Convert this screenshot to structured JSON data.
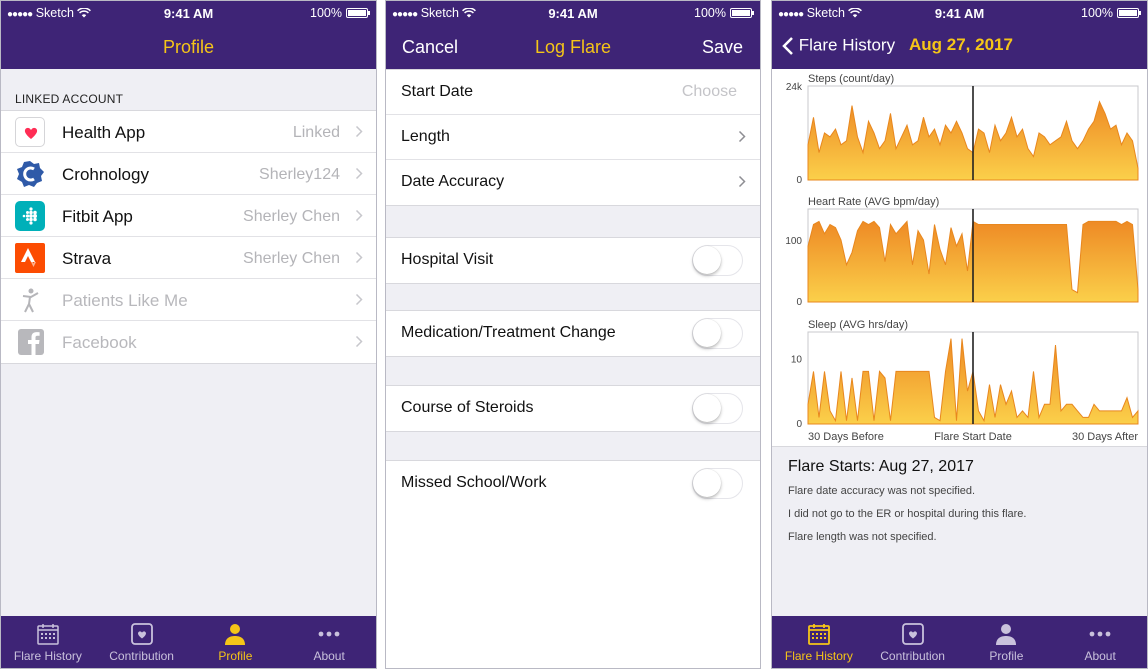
{
  "status": {
    "carrier": "Sketch",
    "time": "9:41 AM",
    "battery": "100%",
    "battery_level": 1.0
  },
  "colors": {
    "nav_bg": "#3e2476",
    "accent": "#f5c518",
    "chart_fill": "#f5a623",
    "chart_line": "#e8871e"
  },
  "profile": {
    "title": "Profile",
    "section_header": "LINKED ACCOUNT",
    "accounts": [
      {
        "label": "Health App",
        "value": "Linked",
        "icon": "health-heart-icon",
        "enabled": true
      },
      {
        "label": "Crohnology",
        "value": "Sherley124",
        "icon": "crohnology-c-icon",
        "enabled": true
      },
      {
        "label": "Fitbit App",
        "value": "Sherley Chen",
        "icon": "fitbit-dots-icon",
        "enabled": true
      },
      {
        "label": "Strava",
        "value": "Sherley Chen",
        "icon": "strava-chevron-icon",
        "enabled": true
      },
      {
        "label": "Patients Like Me",
        "value": "",
        "icon": "person-figure-icon",
        "enabled": false
      },
      {
        "label": "Facebook",
        "value": "",
        "icon": "facebook-f-icon",
        "enabled": false
      }
    ]
  },
  "log_flare": {
    "title": "Log Flare",
    "cancel": "Cancel",
    "save": "Save",
    "start_date": {
      "label": "Start Date",
      "placeholder": "Choose"
    },
    "length": "Length",
    "date_accuracy": "Date Accuracy",
    "toggles": [
      {
        "label": "Hospital Visit",
        "on": false
      },
      {
        "label": "Medication/Treatment Change",
        "on": false
      },
      {
        "label": "Course of Steroids",
        "on": false
      },
      {
        "label": "Missed School/Work",
        "on": false
      }
    ]
  },
  "flare_history": {
    "back_label": "Flare History",
    "date": "Aug 27, 2017",
    "summary_title": "Flare Starts: Aug 27, 2017",
    "notes": [
      "Flare date accuracy was not specified.",
      "I did not go to the ER or hospital during this flare.",
      "Flare length was not specified."
    ],
    "x_labels": {
      "left": "30 Days Before",
      "center": "Flare Start Date",
      "right": "30 Days After"
    }
  },
  "tabs": [
    {
      "label": "Flare History",
      "icon": "calendar-icon"
    },
    {
      "label": "Contribution",
      "icon": "heart-square-icon"
    },
    {
      "label": "Profile",
      "icon": "person-icon"
    },
    {
      "label": "About",
      "icon": "ellipsis-icon"
    }
  ],
  "chart_data": [
    {
      "type": "area",
      "title": "Steps (count/day)",
      "ylim": [
        0,
        24000
      ],
      "ytick_labels": [
        "24k",
        "0"
      ],
      "x": [
        -30,
        -29,
        -28,
        -27,
        -26,
        -25,
        -24,
        -23,
        -22,
        -21,
        -20,
        -19,
        -18,
        -17,
        -16,
        -15,
        -14,
        -13,
        -12,
        -11,
        -10,
        -9,
        -8,
        -7,
        -6,
        -5,
        -4,
        -3,
        -2,
        -1,
        0,
        1,
        2,
        3,
        4,
        5,
        6,
        7,
        8,
        9,
        10,
        11,
        12,
        13,
        14,
        15,
        16,
        17,
        18,
        19,
        20,
        21,
        22,
        23,
        24,
        25,
        26,
        27,
        28,
        29,
        30
      ],
      "values": [
        9000,
        16000,
        7000,
        12000,
        11000,
        13000,
        9000,
        10000,
        19000,
        11000,
        7000,
        15000,
        12000,
        8000,
        10000,
        17000,
        8000,
        11000,
        14000,
        9000,
        10000,
        16000,
        11000,
        13000,
        9000,
        14000,
        12000,
        15000,
        12000,
        8000,
        7000,
        13000,
        12000,
        7000,
        14000,
        10000,
        12000,
        16000,
        11000,
        13000,
        8000,
        6000,
        12000,
        11000,
        9000,
        10000,
        11000,
        15000,
        10000,
        8000,
        10000,
        13000,
        15000,
        20000,
        17000,
        13000,
        14000,
        9000,
        12000,
        10000,
        3000
      ],
      "marker_x": 0
    },
    {
      "type": "area",
      "title": "Heart Rate (AVG bpm/day)",
      "ylim": [
        0,
        150
      ],
      "ytick_labels": [
        "100",
        "0"
      ],
      "x": [
        -30,
        -29,
        -28,
        -27,
        -26,
        -25,
        -24,
        -23,
        -22,
        -21,
        -20,
        -19,
        -18,
        -17,
        -16,
        -15,
        -14,
        -13,
        -12,
        -11,
        -10,
        -9,
        -8,
        -7,
        -6,
        -5,
        -4,
        -3,
        -2,
        -1,
        0,
        1,
        2,
        3,
        4,
        5,
        6,
        7,
        8,
        9,
        10,
        11,
        12,
        13,
        14,
        15,
        16,
        17,
        18,
        19,
        20,
        21,
        22,
        23,
        24,
        25,
        26,
        27,
        28,
        29,
        30
      ],
      "values": [
        90,
        125,
        130,
        110,
        125,
        120,
        100,
        60,
        80,
        115,
        130,
        125,
        130,
        120,
        65,
        125,
        110,
        120,
        130,
        60,
        115,
        100,
        45,
        125,
        85,
        60,
        120,
        90,
        110,
        50,
        130,
        125,
        125,
        125,
        125,
        125,
        125,
        125,
        125,
        125,
        125,
        125,
        125,
        125,
        125,
        125,
        125,
        125,
        20,
        15,
        125,
        130,
        130,
        130,
        130,
        130,
        130,
        125,
        130,
        125,
        20
      ],
      "marker_x": 0
    },
    {
      "type": "area",
      "title": "Sleep (AVG hrs/day)",
      "ylim": [
        0,
        14
      ],
      "ytick_labels": [
        "10",
        "0"
      ],
      "x": [
        -30,
        -29,
        -28,
        -27,
        -26,
        -25,
        -24,
        -23,
        -22,
        -21,
        -20,
        -19,
        -18,
        -17,
        -16,
        -15,
        -14,
        -13,
        -12,
        -11,
        -10,
        -9,
        -8,
        -7,
        -6,
        -5,
        -4,
        -3,
        -2,
        -1,
        0,
        1,
        2,
        3,
        4,
        5,
        6,
        7,
        8,
        9,
        10,
        11,
        12,
        13,
        14,
        15,
        16,
        17,
        18,
        19,
        20,
        21,
        22,
        23,
        24,
        25,
        26,
        27,
        28,
        29,
        30
      ],
      "values": [
        3,
        8,
        1,
        8,
        2,
        0.5,
        8,
        0.5,
        7,
        0.5,
        8,
        8,
        0.5,
        8,
        7,
        0.5,
        8,
        8,
        8,
        8,
        8,
        8,
        8,
        1,
        0.5,
        8,
        13,
        0.5,
        13,
        5,
        8,
        2,
        0.5,
        6,
        1,
        6,
        3,
        5,
        1,
        2,
        1,
        8,
        1,
        3,
        3,
        12,
        2,
        3,
        3,
        2,
        1,
        1,
        3,
        2,
        2,
        2,
        2,
        2,
        4,
        1,
        2
      ],
      "marker_x": 0
    }
  ]
}
